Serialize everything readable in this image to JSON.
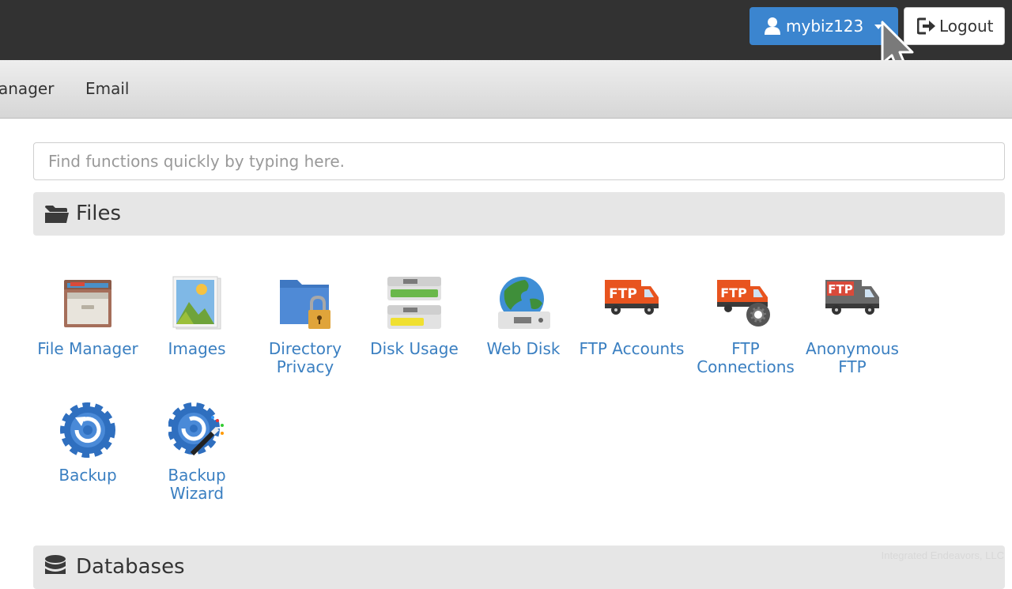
{
  "header": {
    "username": "mybiz123",
    "logout_label": "Logout"
  },
  "nav": {
    "items": [
      "anager",
      "Email"
    ]
  },
  "search": {
    "placeholder": "Find functions quickly by typing here."
  },
  "sections": {
    "files": {
      "title": "Files",
      "apps": [
        {
          "label": "File Manager",
          "icon": "file-manager-icon"
        },
        {
          "label": "Images",
          "icon": "images-icon"
        },
        {
          "label": "Directory Privacy",
          "icon": "directory-privacy-icon"
        },
        {
          "label": "Disk Usage",
          "icon": "disk-usage-icon"
        },
        {
          "label": "Web Disk",
          "icon": "web-disk-icon"
        },
        {
          "label": "FTP Accounts",
          "icon": "ftp-accounts-icon"
        },
        {
          "label": "FTP Connections",
          "icon": "ftp-connections-icon"
        },
        {
          "label": "Anonymous FTP",
          "icon": "anonymous-ftp-icon"
        },
        {
          "label": "Backup",
          "icon": "backup-icon"
        },
        {
          "label": "Backup Wizard",
          "icon": "backup-wizard-icon"
        }
      ]
    },
    "databases": {
      "title": "Databases"
    }
  },
  "icons": {
    "ftp_text": "FTP"
  },
  "watermark": "Integrated Endeavors, LLC",
  "colors": {
    "topbar": "#323232",
    "accent": "#3b85cf",
    "link": "#3a7fc1",
    "section_bg": "#e6e6e6"
  }
}
